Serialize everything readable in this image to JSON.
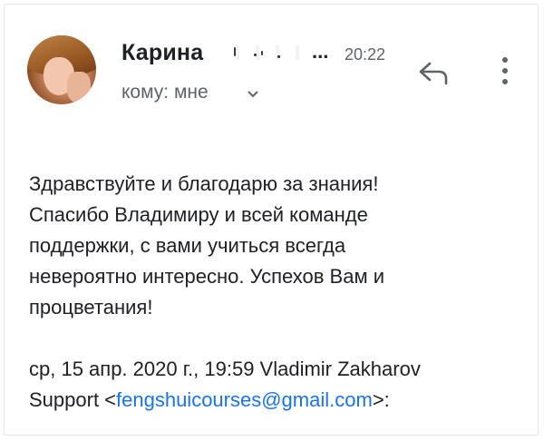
{
  "header": {
    "sender_name": "Карина",
    "ellipsis": "...",
    "time": "20:22",
    "recipient": "кому: мне"
  },
  "icons": {
    "reply": "reply-icon",
    "more": "more-vert-icon",
    "expand": "chevron-down-icon"
  },
  "message": {
    "lines": [
      "Здравствуйте и благодарю за знания!",
      "Спасибо Владимиру и всей команде",
      "поддержки, с вами учиться всегда",
      "невероятно интересно. Успехов Вам и",
      "процветания!"
    ]
  },
  "quote": {
    "line1": "ср, 15 апр. 2020 г., 19:59 Vladimir Zakharov",
    "prefix": "Support <",
    "email": "fengshuicourses@gmail.com",
    "suffix": ">:"
  },
  "colors": {
    "link": "#1a73e8",
    "secondary": "#5f6368",
    "text": "#202124"
  }
}
